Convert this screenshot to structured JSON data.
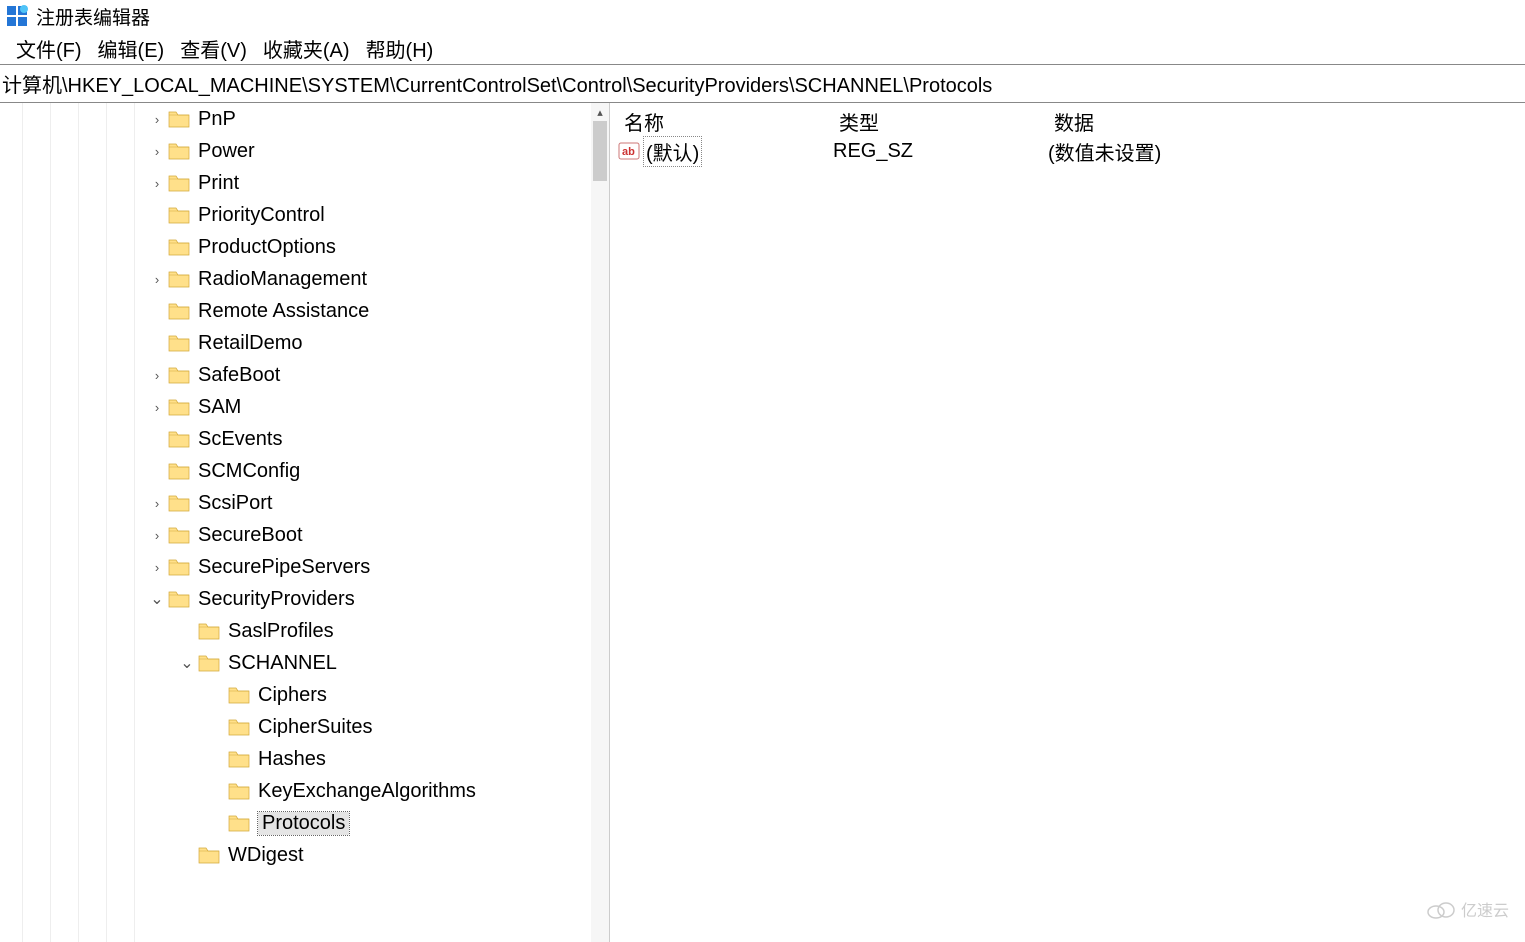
{
  "app": {
    "title": "注册表编辑器"
  },
  "menu": {
    "file": "文件(F)",
    "edit": "编辑(E)",
    "view": "查看(V)",
    "favorites": "收藏夹(A)",
    "help": "帮助(H)"
  },
  "address": "计算机\\HKEY_LOCAL_MACHINE\\SYSTEM\\CurrentControlSet\\Control\\SecurityProviders\\SCHANNEL\\Protocols",
  "tree": {
    "items": [
      {
        "label": "PnP",
        "expandable": true,
        "indent": 5
      },
      {
        "label": "Power",
        "expandable": true,
        "indent": 5
      },
      {
        "label": "Print",
        "expandable": true,
        "indent": 5
      },
      {
        "label": "PriorityControl",
        "expandable": false,
        "indent": 5
      },
      {
        "label": "ProductOptions",
        "expandable": false,
        "indent": 5
      },
      {
        "label": "RadioManagement",
        "expandable": true,
        "indent": 5
      },
      {
        "label": "Remote Assistance",
        "expandable": false,
        "indent": 5
      },
      {
        "label": "RetailDemo",
        "expandable": false,
        "indent": 5
      },
      {
        "label": "SafeBoot",
        "expandable": true,
        "indent": 5
      },
      {
        "label": "SAM",
        "expandable": true,
        "indent": 5
      },
      {
        "label": "ScEvents",
        "expandable": false,
        "indent": 5
      },
      {
        "label": "SCMConfig",
        "expandable": false,
        "indent": 5
      },
      {
        "label": "ScsiPort",
        "expandable": true,
        "indent": 5
      },
      {
        "label": "SecureBoot",
        "expandable": true,
        "indent": 5
      },
      {
        "label": "SecurePipeServers",
        "expandable": true,
        "indent": 5
      },
      {
        "label": "SecurityProviders",
        "expandable": true,
        "expanded": true,
        "indent": 5
      },
      {
        "label": "SaslProfiles",
        "expandable": false,
        "indent": 6
      },
      {
        "label": "SCHANNEL",
        "expandable": true,
        "expanded": true,
        "indent": 6
      },
      {
        "label": "Ciphers",
        "expandable": false,
        "indent": 7
      },
      {
        "label": "CipherSuites",
        "expandable": false,
        "indent": 7
      },
      {
        "label": "Hashes",
        "expandable": false,
        "indent": 7
      },
      {
        "label": "KeyExchangeAlgorithms",
        "expandable": false,
        "indent": 7
      },
      {
        "label": "Protocols",
        "expandable": false,
        "indent": 7,
        "selected": true
      },
      {
        "label": "WDigest",
        "expandable": false,
        "indent": 6
      }
    ]
  },
  "values": {
    "header": {
      "name": "名称",
      "type": "类型",
      "data": "数据"
    },
    "rows": [
      {
        "name": "(默认)",
        "type": "REG_SZ",
        "data": "(数值未设置)"
      }
    ]
  },
  "watermark": "亿速云"
}
